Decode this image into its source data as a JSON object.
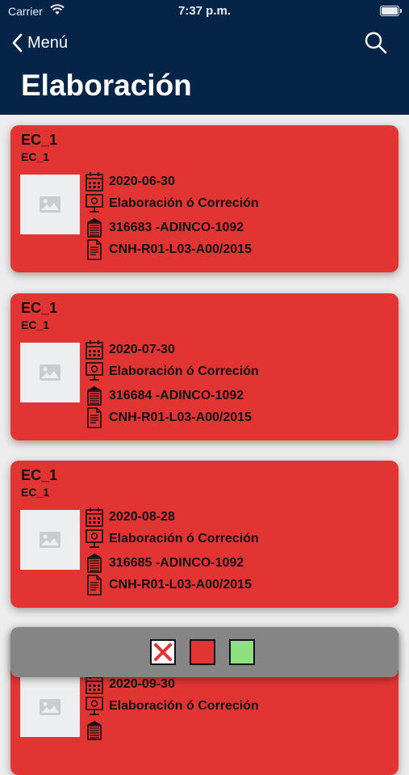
{
  "status": {
    "carrier": "Carrier",
    "time": "7:37 p.m."
  },
  "nav": {
    "back_label": "Menú",
    "title": "Elaboración"
  },
  "cards": [
    {
      "title": "EC_1",
      "subtitle": "EC_1",
      "date": "2020-06-30",
      "stage": "Elaboración ó Correción",
      "contract": "316683 -ADINCO-1092",
      "document": "CNH-R01-L03-A00/2015"
    },
    {
      "title": "EC_1",
      "subtitle": "EC_1",
      "date": "2020-07-30",
      "stage": "Elaboración ó Correción",
      "contract": "316684 -ADINCO-1092",
      "document": "CNH-R01-L03-A00/2015"
    },
    {
      "title": "EC_1",
      "subtitle": "EC_1",
      "date": "2020-08-28",
      "stage": "Elaboración ó Correción",
      "contract": "316685 -ADINCO-1092",
      "document": "CNH-R01-L03-A00/2015"
    },
    {
      "title": "",
      "subtitle": "",
      "date": "2020-09-30",
      "stage": "Elaboración ó Correción",
      "contract": "",
      "document": ""
    }
  ],
  "filter_options": [
    {
      "name": "none",
      "color": "#ffffff"
    },
    {
      "name": "red",
      "color": "#e23533"
    },
    {
      "name": "green",
      "color": "#8ee07e"
    }
  ],
  "colors": {
    "header": "#062447",
    "card": "#e23533",
    "overlay": "#858585"
  }
}
